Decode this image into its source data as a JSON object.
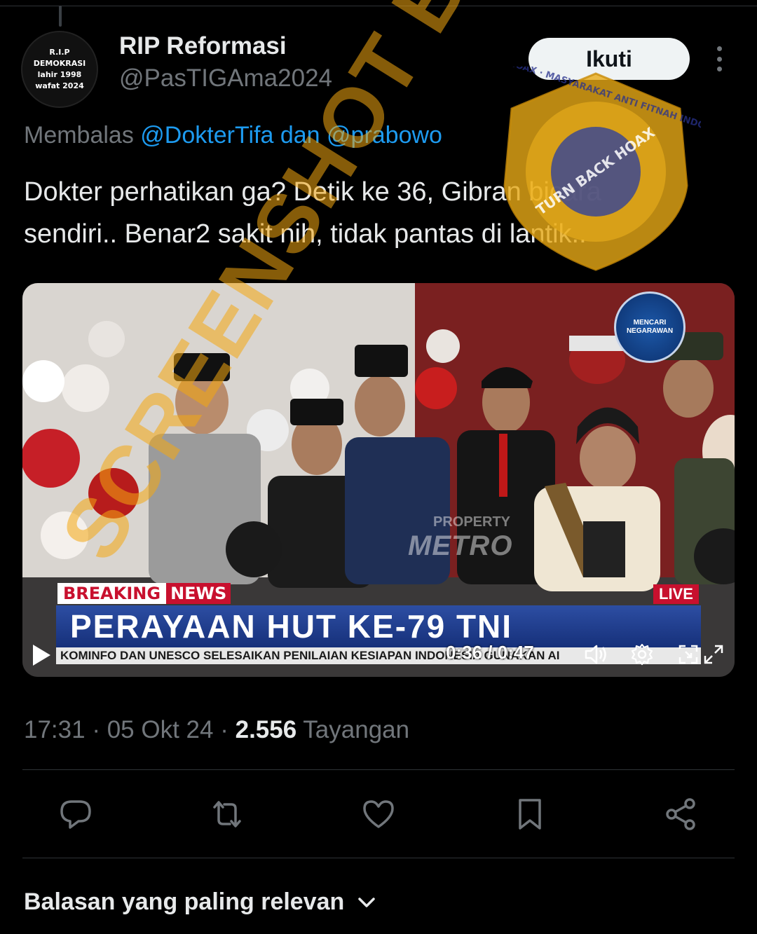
{
  "author": {
    "avatar_lines": [
      "R.I.P",
      "DEMOKRASI",
      "lahir 1998",
      "wafat 2024"
    ],
    "name": "RIP Reformasi",
    "handle": "@PasTIGAma2024"
  },
  "follow_label": "Ikuti",
  "replying": {
    "prefix": "Membalas",
    "mention1": "@DokterTifa",
    "connector": "dan",
    "mention2": "@prabowo"
  },
  "tweet": {
    "line1": "Dokter perhatikan ga? Detik ke 36, Gibran bicara",
    "line2": "sendiri.. Benar2 sakit nih, tidak pantas di lantik.."
  },
  "video": {
    "breaking_1": "BREAKING",
    "breaking_2": "NEWS",
    "live": "LIVE",
    "headline": "PERAYAAN HUT KE-79 TNI",
    "ticker": "KOMINFO DAN UNESCO SELESAIKAN PENILAIAN KESIAPAN INDONESIA GUNAKAN AI",
    "time": "0:36 / 0:47",
    "corner_logo_line1": "MENCARI",
    "corner_logo_line2": "NEGARAWAN",
    "brand_small": "PROPERTY",
    "brand_big": "METRO",
    "played_fraction": 0.766
  },
  "meta": {
    "time": "17:31",
    "date": "05 Okt 24",
    "views_count": "2.556",
    "views_label": "Tayangan"
  },
  "sort_label": "Balasan yang paling relevan",
  "overlay": {
    "watermark": "SCREENSHOT BY",
    "badge_ring": "TURN BACK HOAX · MASYARAKAT ANTI FITNAH INDONESIA · MAFINDO",
    "badge_center": "TURN BACK HOAX",
    "watermark_color": "#f4a710"
  },
  "colors": {
    "link": "#1d9bf0",
    "muted": "#71767b",
    "background": "#000000"
  }
}
